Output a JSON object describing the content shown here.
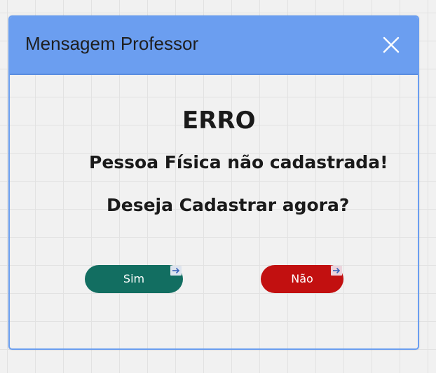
{
  "dialog": {
    "title": "Mensagem Professor",
    "close_icon": "close-icon",
    "heading": "ERRO",
    "message_line1": "Pessoa Física não cadastrada!",
    "message_line2": "Deseja Cadastrar agora?",
    "confirm_label": "Sim",
    "cancel_label": "Não",
    "button_badge_icon": "arrow-right-icon"
  },
  "colors": {
    "titlebar": "#6b9ef0",
    "dialog_border": "#6a9ef0",
    "confirm_button": "#126e61",
    "cancel_button": "#c21010",
    "text": "#1a1a1a"
  }
}
